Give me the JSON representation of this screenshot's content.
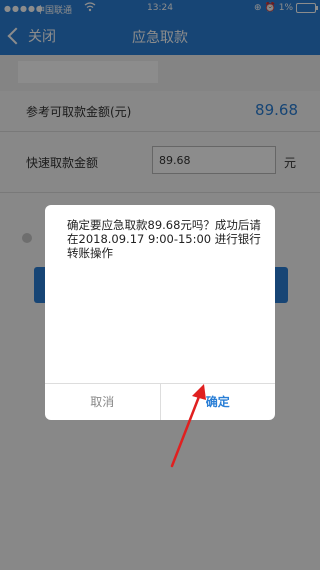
{
  "status_bar": {
    "carrier": "中国联通",
    "time": "13:24",
    "battery": "1%",
    "signal_icon": "signal-dots",
    "wifi_icon": "wifi-icon",
    "lock_icon": "orientation-lock-icon",
    "alarm_icon": "alarm-icon"
  },
  "nav": {
    "back_label": "关闭",
    "title": "应急取款"
  },
  "form": {
    "reference_label": "参考可取款金额(元)",
    "reference_amount": "89.68",
    "quick_label": "快速取款金额",
    "quick_value": "89.68",
    "unit": "元"
  },
  "dialog": {
    "message": "确定要应急取款89.68元吗？成功后请在2018.09.17 9:00-15:00 进行银行转账操作",
    "cancel_label": "取消",
    "confirm_label": "确定"
  },
  "colors": {
    "brand_blue": "#2a7fd6",
    "annotation_red": "#e02020"
  }
}
